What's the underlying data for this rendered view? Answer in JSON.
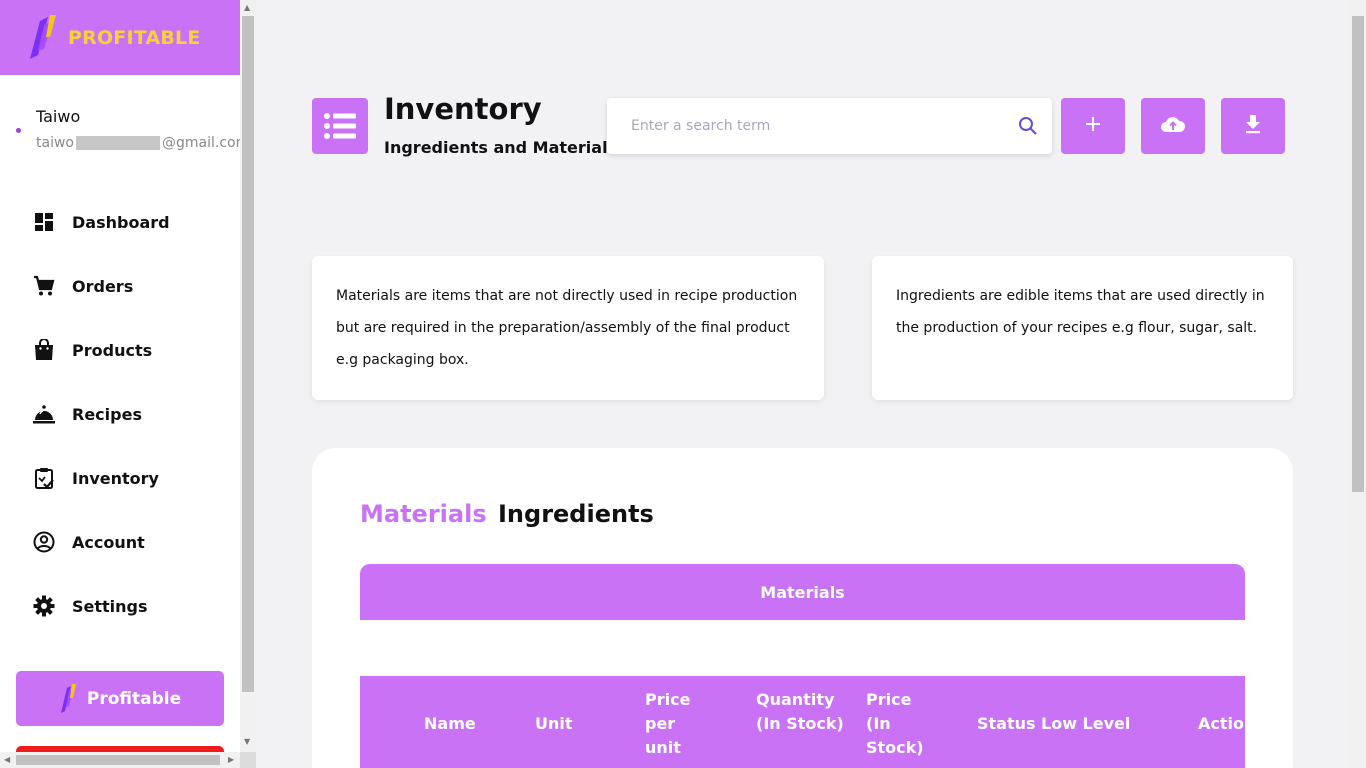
{
  "brand": {
    "name": "PROFITABLE"
  },
  "user": {
    "name": "Taiwo",
    "email_prefix": "taiwo",
    "email_suffix": "@gmail.com"
  },
  "nav": [
    {
      "label": "Dashboard",
      "icon": "dashboard-icon"
    },
    {
      "label": "Orders",
      "icon": "cart-icon"
    },
    {
      "label": "Products",
      "icon": "shopping-bag-icon"
    },
    {
      "label": "Recipes",
      "icon": "room-service-bell-icon"
    },
    {
      "label": "Inventory",
      "icon": "clipboard-check-icon"
    },
    {
      "label": "Account",
      "icon": "account-circle-icon"
    },
    {
      "label": "Settings",
      "icon": "gear-icon"
    }
  ],
  "promo": {
    "label": "Profitable"
  },
  "header": {
    "title": "Inventory",
    "subtitle": "Ingredients and Materials",
    "icon": "list-icon"
  },
  "search": {
    "placeholder": "Enter a search term",
    "value": ""
  },
  "actions": [
    {
      "name": "add-button",
      "icon": "plus-icon"
    },
    {
      "name": "upload-button",
      "icon": "cloud-upload-icon"
    },
    {
      "name": "download-button",
      "icon": "download-icon"
    }
  ],
  "info": {
    "materials": "Materials are items that are not directly used in recipe production but are required in the preparation/assembly of the final product e.g packaging box.",
    "ingredients": "Ingredients are edible items that are used directly in the production of your recipes e.g flour, sugar, salt."
  },
  "tabs": {
    "materials": "Materials",
    "ingredients": "Ingredients",
    "active": "Materials"
  },
  "table": {
    "title": "Materials",
    "columns": [
      "Name",
      "Unit",
      "Price per unit",
      "Quantity (In Stock)",
      "Price (In Stock)",
      "Status",
      "Low Level",
      "Action"
    ]
  },
  "colors": {
    "accent": "#c972f5",
    "brand_text": "#f5d23b",
    "background": "#f2f2f5",
    "danger": "#f01c1c"
  }
}
